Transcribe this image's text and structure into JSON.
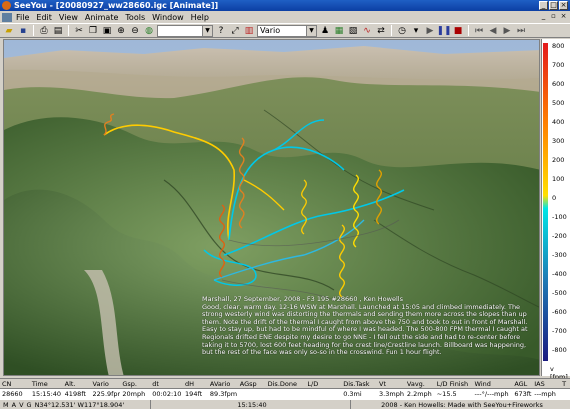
{
  "window": {
    "title": "SeeYou - [20080927_ww28660.igc [Animate]]"
  },
  "menu": [
    {
      "label": "File"
    },
    {
      "label": "Edit"
    },
    {
      "label": "View"
    },
    {
      "label": "Animate"
    },
    {
      "label": "Tools"
    },
    {
      "label": "Window"
    },
    {
      "label": "Help"
    }
  ],
  "toolbar": {
    "vario_select": "Vario"
  },
  "note": {
    "title": "Marshall, 27 September,  2008 - F3 195 #28660 , Ken Howells",
    "body": "Good, clear, warm day.  12-16 WSW at Marshall.  Launched at 15:05 and climbed immediately.  The strong westerly wind was distorting the thermals and sending them more across the slopes than up them.  Note the drift of the thermal I caught from above the 750 and took to out in front of Marshall.  Easy to stay up, but had to be mindful of where I was headed.  The 500-800 FPM thermal I caught at Regionals drifted ENE despite my desire to go NNE - I fell out the side and had to re-center before taking it to 5700, lost 600 feet heading for the crest line/Crestline launch.  Billboard was happening, but the rest of the face was only so-so in the crosswind.  Fun 1 hour flight."
  },
  "scale": {
    "ticks": [
      "800",
      "700",
      "600",
      "500",
      "400",
      "300",
      "200",
      "100",
      "0",
      "-100",
      "-200",
      "-300",
      "-400",
      "-500",
      "-600",
      "-700",
      "-800"
    ],
    "unit": "v [fpm]",
    "colors": [
      "#e31a1c",
      "#ff7f00",
      "#ffe000",
      "#00e5e5",
      "#1f78b4",
      "#1a1a80"
    ]
  },
  "table": {
    "headers": [
      "CN",
      "Time",
      "Alt.",
      "Vario",
      "Gsp.",
      "dt",
      "dH",
      "AVario",
      "AGsp",
      "Dis.Done",
      "L/D",
      "Dis.Task",
      "Vt",
      "Vavg.",
      "L/D Finish",
      "Wind",
      "AGL",
      "IAS",
      "T"
    ],
    "rows": [
      [
        "28660",
        "15:15:40",
        "4198ft",
        "225.9fpm",
        "20mph",
        "00:02:10",
        "194ft",
        "89.3fpm",
        "",
        "",
        "",
        "0.3mi",
        "3.3mph",
        "2.2mph",
        "~15.5",
        "---°/---mph",
        "673ft",
        "---mph",
        ""
      ]
    ]
  },
  "status": {
    "left": [
      "M",
      "A",
      "V",
      "G"
    ],
    "position": "N34°12.531'  W117°18.904'",
    "time": "15:15:40",
    "credit": "2008 - Ken Howells: Made with SeeYou+Fireworks"
  }
}
